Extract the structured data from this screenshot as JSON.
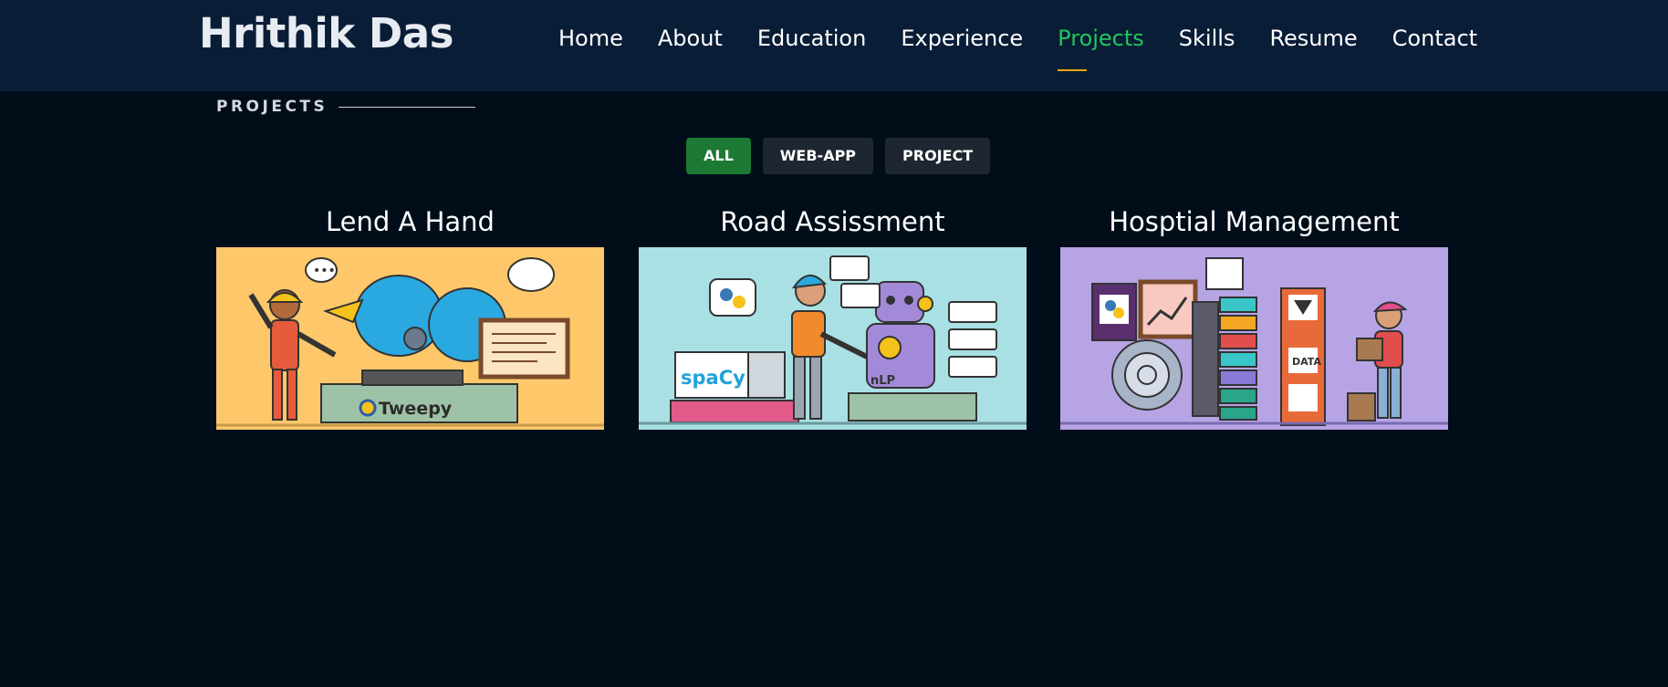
{
  "header": {
    "logo": "Hrithik Das",
    "nav": [
      "Home",
      "About",
      "Education",
      "Experience",
      "Projects",
      "Skills",
      "Resume",
      "Contact"
    ],
    "active_nav": "Projects"
  },
  "section": {
    "title": "PROJECTS"
  },
  "filters": [
    "ALL",
    "WEB-APP",
    "PROJECT"
  ],
  "active_filter": "ALL",
  "projects": [
    {
      "title": "Lend A Hand",
      "image_text": "Tweepy",
      "bg": "#fec86a"
    },
    {
      "title": "Road Assissment",
      "image_text": "spaCy",
      "image_label": "nLP",
      "bg": "#a9e0e4"
    },
    {
      "title": "Hosptial Management",
      "image_text": "DATA",
      "bg": "#b6a4e4"
    }
  ],
  "colors": {
    "nav_bg": "#0a1d37",
    "page_bg": "#020d1a",
    "accent": "#22c55e",
    "filter_active": "#1d7a34"
  }
}
